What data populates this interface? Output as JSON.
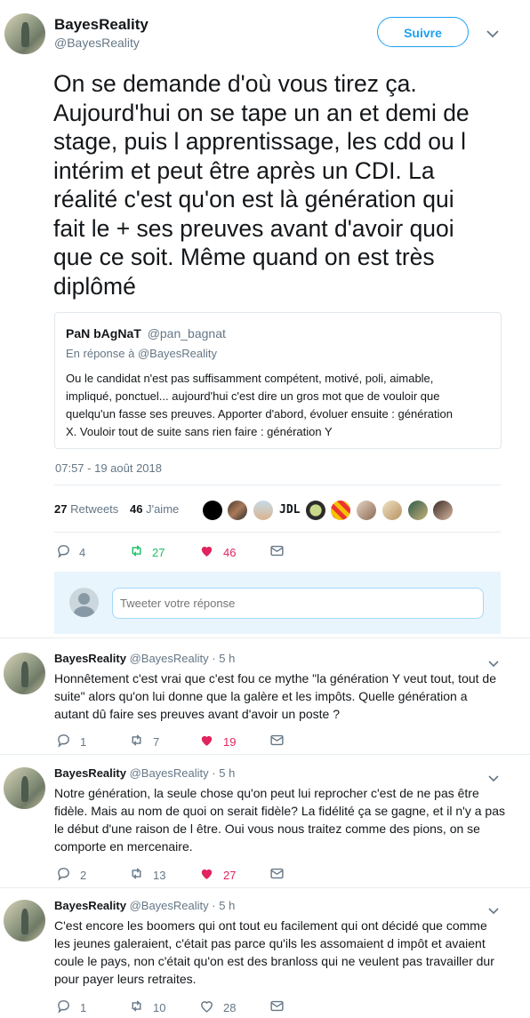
{
  "tweet": {
    "author_name": "BayesReality",
    "author_handle": "@BayesReality",
    "follow_label": "Suivre",
    "text": "On se demande d'où vous tirez ça.\nAujourd'hui on se tape un an et demi de\nstage, puis l apprentissage, les cdd ou l\nintérim et peut être après un CDI. La\nréalité c'est qu'on est là génération qui\nfait le + ses preuves avant d'avoir quoi\nque ce soit. Même quand on est très\ndiplômé",
    "timestamp": "07:57 - 19 août 2018",
    "retweets_count": "27",
    "retweets_label": "Retweets",
    "likes_count": "46",
    "likes_label": "J'aime",
    "liker_text_avatar": "JDL",
    "actions": {
      "replies": "4",
      "retweets": "27",
      "likes": "46"
    }
  },
  "quoted": {
    "name": "PaN bAgNaT",
    "handle": "@pan_bagnat",
    "reply_to": "En réponse à @BayesReality",
    "text": "Ou le candidat n'est pas suffisamment compétent, motivé, poli, aimable,\nimpliqué, ponctuel... aujourd'hui c'est dire un gros mot que de vouloir que\nquelqu'un fasse ses preuves. Apporter d'abord, évoluer ensuite : génération\nX. Vouloir tout de suite sans rien faire : génération Y"
  },
  "composer": {
    "placeholder": "Tweeter votre réponse"
  },
  "replies": [
    {
      "name": "BayesReality",
      "handle": "@BayesReality",
      "time": "· 5 h",
      "text": "Honnêtement c'est vrai que c'est fou ce mythe \"la génération Y veut tout, tout de\nsuite\" alors qu'on lui donne que la galère et les impôts. Quelle génération a\nautant dû faire ses preuves avant d'avoir un poste ?",
      "replies": "1",
      "retweets": "7",
      "likes": "19"
    },
    {
      "name": "BayesReality",
      "handle": "@BayesReality",
      "time": "· 5 h",
      "text": "Notre génération, la seule chose qu'on peut lui reprocher c'est de ne pas être\nfidèle. Mais au nom de quoi on serait fidèle? La fidélité ça se gagne, et il n'y a pas\nle début d'une raison de l être. Oui vous nous traitez comme des pions, on se\ncomporte en mercenaire.",
      "replies": "2",
      "retweets": "13",
      "likes": "27"
    },
    {
      "name": "BayesReality",
      "handle": "@BayesReality",
      "time": "· 5 h",
      "text": "C'est encore les boomers qui ont tout eu facilement qui ont décidé que comme\nles jeunes galeraient, c'était pas parce qu'ils les assomaient d impôt et avaient\ncoule le pays, non c'était qu'on est des branloss qui ne veulent pas travailler dur\npour payer leurs retraites.",
      "replies": "1",
      "retweets": "10",
      "likes": "28"
    }
  ],
  "colors": {
    "accent": "#1da1f2",
    "retweet": "#17bf63",
    "like": "#e0245e",
    "muted": "#657786"
  }
}
